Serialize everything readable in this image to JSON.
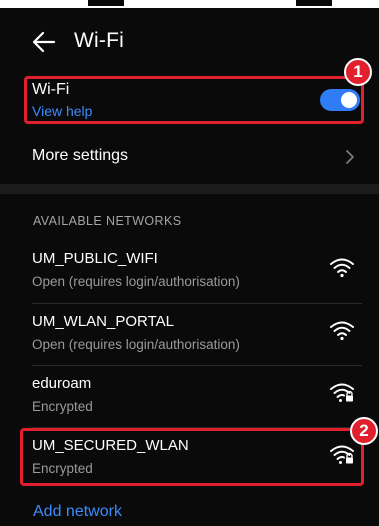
{
  "header": {
    "title": "Wi-Fi"
  },
  "wifi": {
    "label": "Wi-Fi",
    "help": "View help",
    "enabled": true
  },
  "more_settings": {
    "label": "More settings"
  },
  "networks": {
    "heading": "AVAILABLE NETWORKS",
    "items": [
      {
        "name": "UM_PUBLIC_WIFI",
        "status": "Open (requires login/authorisation)",
        "icon": "wifi-signal-icon"
      },
      {
        "name": "UM_WLAN_PORTAL",
        "status": "Open (requires login/authorisation)",
        "icon": "wifi-signal-icon"
      },
      {
        "name": "eduroam",
        "status": "Encrypted",
        "icon": "wifi-lock-icon"
      },
      {
        "name": "UM_SECURED_WLAN",
        "status": "Encrypted",
        "icon": "wifi-lock-icon"
      }
    ]
  },
  "add_network": "Add network",
  "annotations": {
    "badge1": "1",
    "badge2": "2"
  },
  "colors": {
    "accent": "#2f7cf6",
    "link": "#3d8bff",
    "highlight": "#e0202c",
    "background": "#0a0a0a"
  }
}
